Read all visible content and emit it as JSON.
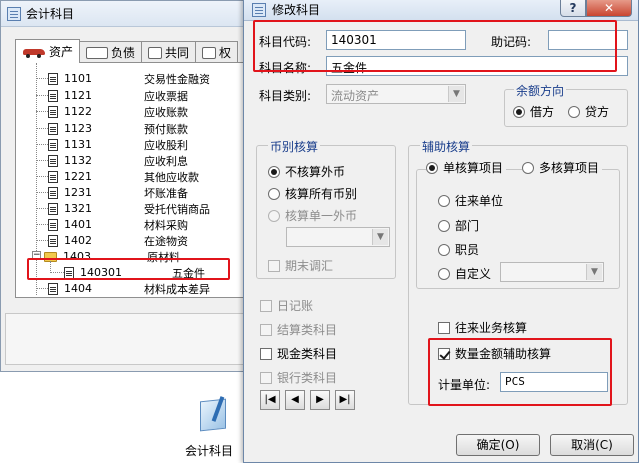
{
  "back_window": {
    "title": "会计科目",
    "tabs": [
      {
        "label": "资产",
        "active": true
      },
      {
        "label": "负债",
        "active": false
      },
      {
        "label": "共同",
        "active": false
      },
      {
        "label": "权",
        "active": false
      }
    ],
    "tree_rows": [
      {
        "code": "1101",
        "name": "交易性金融资"
      },
      {
        "code": "1121",
        "name": "应收票据"
      },
      {
        "code": "1122",
        "name": "应收账款"
      },
      {
        "code": "1123",
        "name": "预付账款"
      },
      {
        "code": "1131",
        "name": "应收股利"
      },
      {
        "code": "1132",
        "name": "应收利息"
      },
      {
        "code": "1221",
        "name": "其他应收款"
      },
      {
        "code": "1231",
        "name": "坏账准备"
      },
      {
        "code": "1321",
        "name": "受托代销商品"
      },
      {
        "code": "1401",
        "name": "材料采购"
      },
      {
        "code": "1402",
        "name": "在途物资"
      },
      {
        "code": "1403",
        "name": "原材料"
      },
      {
        "code": "140301",
        "name": "五金件"
      },
      {
        "code": "1404",
        "name": "材料成本差异"
      }
    ],
    "icon_label": "会计科目"
  },
  "dialog": {
    "title": "修改科目",
    "help": "?",
    "close": "✕",
    "code_label": "科目代码:",
    "code_value": "140301",
    "mnemonic_label": "助记码:",
    "mnemonic_value": "",
    "name_label": "科目名称:",
    "name_value": "五金件",
    "category_label": "科目类别:",
    "category_value": "流动资产",
    "balance_group": "余额方向",
    "balance_debit": "借方",
    "balance_credit": "贷方",
    "currency_group": "币别核算",
    "cur_none": "不核算外币",
    "cur_all": "核算所有币别",
    "cur_single": "核算单一外币",
    "cur_adjust": "期末调汇",
    "aux_group": "辅助核算",
    "aux_single": "单核算项目",
    "aux_multi": "多核算项目",
    "aux_items": [
      "往来单位",
      "部门",
      "职员",
      "自定义"
    ],
    "checks": [
      {
        "label": "日记账",
        "checked": false,
        "disabled": true
      },
      {
        "label": "结算类科目",
        "checked": false,
        "disabled": true
      },
      {
        "label": "现金类科目",
        "checked": false,
        "disabled": false
      },
      {
        "label": "银行类科目",
        "checked": false,
        "disabled": true
      }
    ],
    "aux_trade": "往来业务核算",
    "qty_aux": "数量金额辅助核算",
    "unit_label": "计量单位:",
    "unit_value": "PCS",
    "nav_glyphs": [
      "|◀",
      "◀",
      "▶",
      "▶|"
    ],
    "ok_label": "确定(O)",
    "cancel_label": "取消(C)"
  },
  "colors": {
    "highlight": "#e1141b",
    "group_title": "#1a3e8c"
  }
}
